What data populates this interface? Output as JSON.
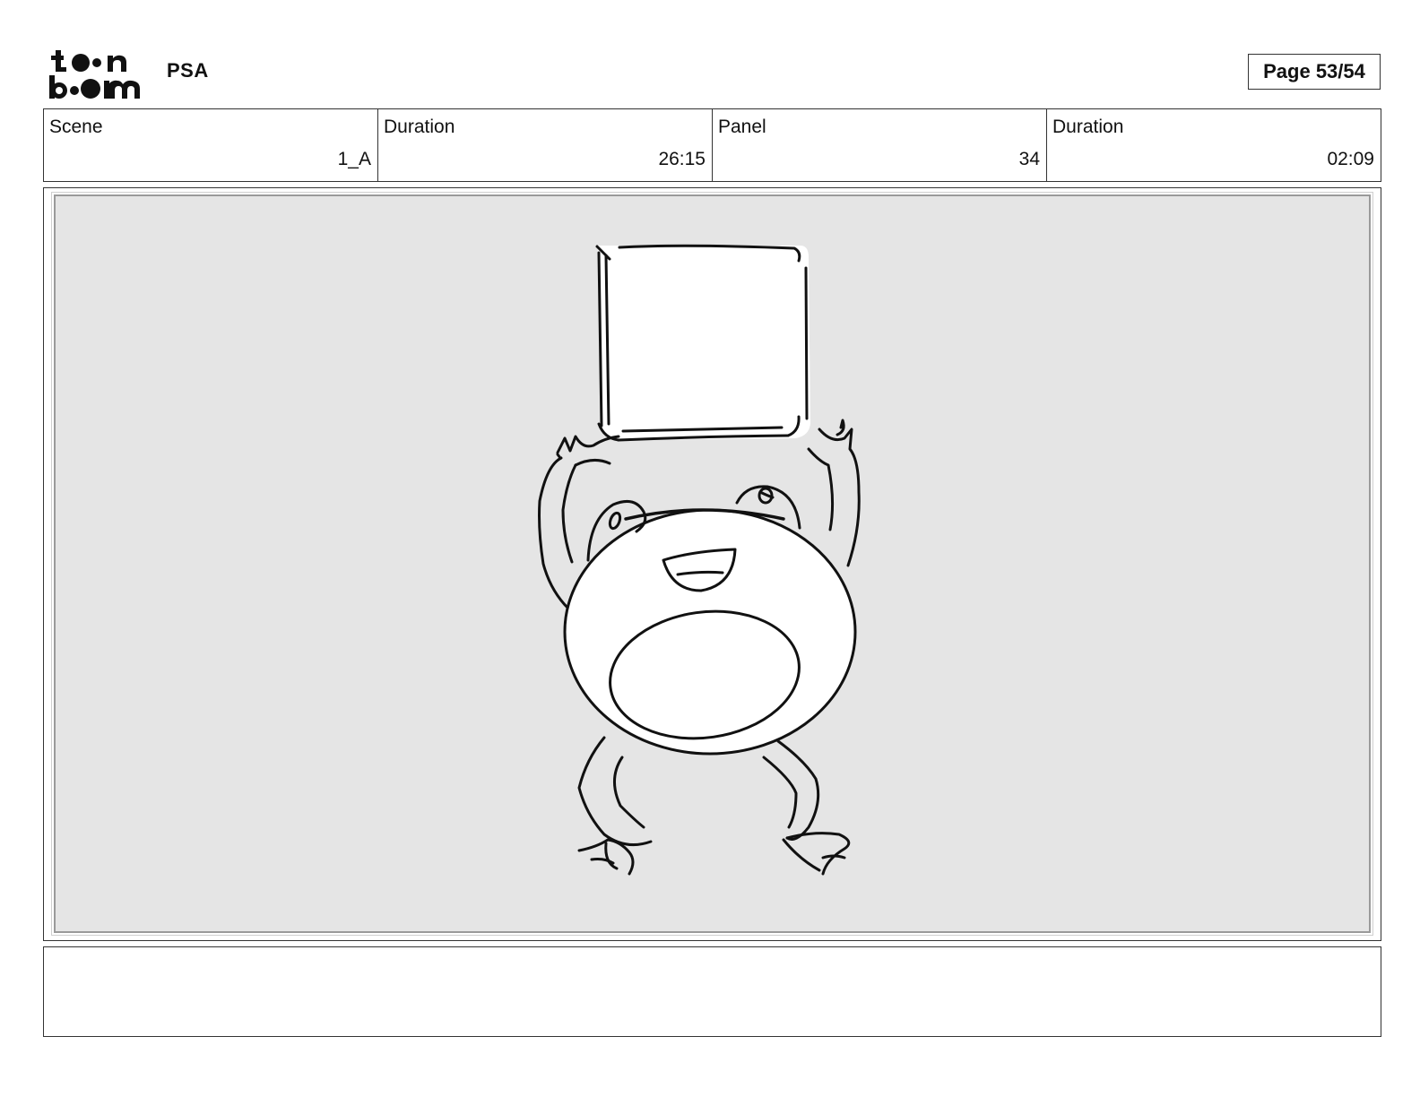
{
  "header": {
    "project_title": "PSA",
    "page_label": "Page 53/54"
  },
  "info": {
    "scene_label": "Scene",
    "scene_value": "1_A",
    "scene_duration_label": "Duration",
    "scene_duration_value": "26:15",
    "panel_label": "Panel",
    "panel_value": "34",
    "panel_duration_label": "Duration",
    "panel_duration_value": "02:09"
  },
  "panel": {
    "background_color": "#e5e5e5",
    "line_color": "#111111"
  },
  "notes": {
    "text": ""
  }
}
